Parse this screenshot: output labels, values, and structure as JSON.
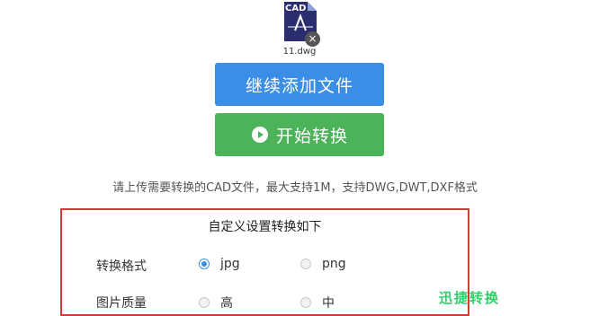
{
  "file": {
    "icon_text": "CAD",
    "name": "11.dwg",
    "remove_glyph": "×"
  },
  "buttons": {
    "add_files": "继续添加文件",
    "start_convert": "开始转换"
  },
  "hint": "请上传需要转换的CAD文件，最大支持1M，支持DWG,DWT,DXF格式",
  "settings": {
    "title": "自定义设置转换如下",
    "format": {
      "label": "转换格式",
      "options": [
        {
          "label": "jpg",
          "checked": true
        },
        {
          "label": "png",
          "checked": false
        }
      ]
    },
    "quality": {
      "label": "图片质量",
      "options": [
        {
          "label": "高",
          "checked": false
        },
        {
          "label": "中",
          "checked": false
        }
      ]
    }
  },
  "watermark": "迅捷转换",
  "colors": {
    "primary": "#3a8ee6",
    "success": "#4cb35a",
    "highlight_border": "#d33a3a"
  }
}
